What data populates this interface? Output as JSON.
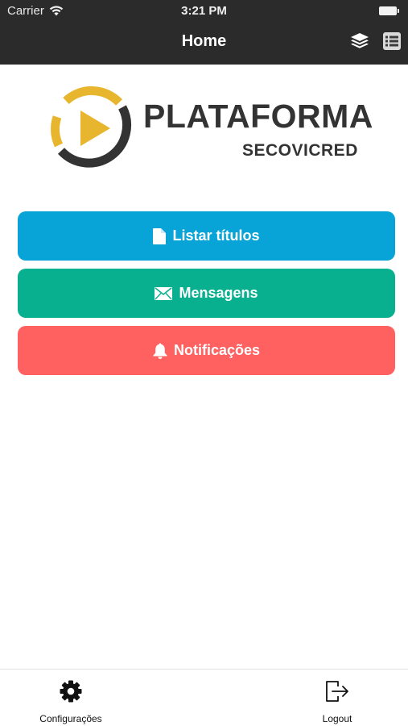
{
  "status_bar": {
    "carrier": "Carrier",
    "time": "3:21 PM"
  },
  "nav": {
    "title": "Home",
    "icons": [
      "layers-icon",
      "list-icon"
    ]
  },
  "logo": {
    "title": "PLATAFORMA",
    "subtitle": "SECOVICRED",
    "accent_color": "#e8b52f",
    "ring_color": "#333333"
  },
  "actions": [
    {
      "label": "Listar títulos",
      "icon": "document-icon",
      "color": "#08a4d8"
    },
    {
      "label": "Mensagens",
      "icon": "envelope-icon",
      "color": "#09b090"
    },
    {
      "label": "Notificações",
      "icon": "bell-icon",
      "color": "#ff6161"
    }
  ],
  "tabbar": {
    "items": [
      {
        "label": "Configurações",
        "icon": "gear-icon"
      },
      {
        "label": "Logout",
        "icon": "logout-icon"
      }
    ]
  },
  "theme": {
    "header_bg": "#2b2b2c"
  }
}
